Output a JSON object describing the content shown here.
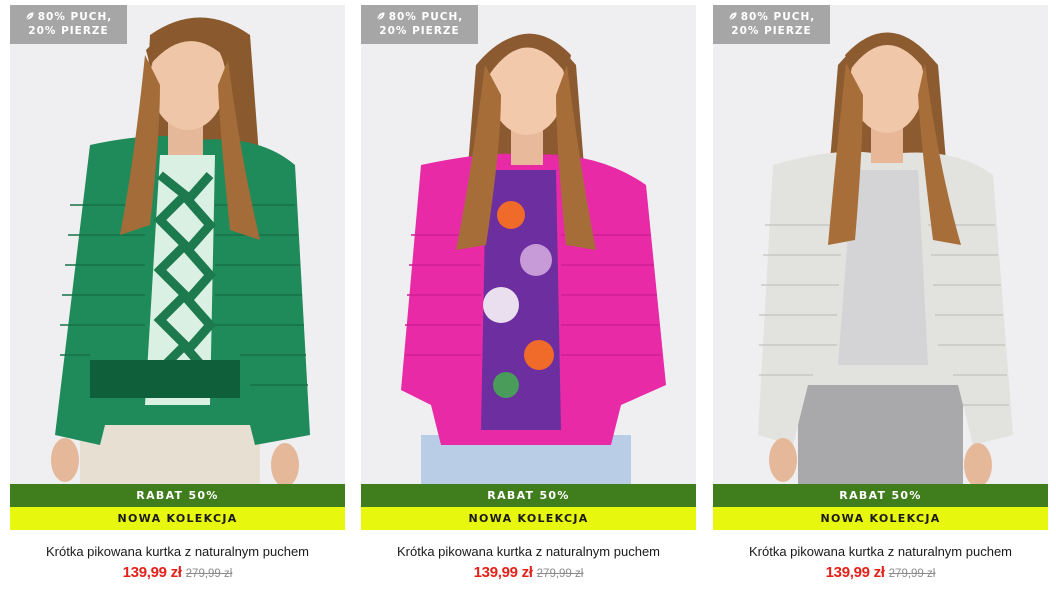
{
  "products": [
    {
      "badge_line1": "80% PUCH,",
      "badge_line2": "20% PIERZE",
      "discount_label": "RABAT 50%",
      "collection_label": "NOWA KOLEKCJA",
      "name": "Krótka pikowana kurtka z naturalnym puchem",
      "price": "139,99 zł",
      "old_price": "279,99 zł",
      "jacket_color": "#1f8a5a"
    },
    {
      "badge_line1": "80% PUCH,",
      "badge_line2": "20% PIERZE",
      "discount_label": "RABAT 50%",
      "collection_label": "NOWA KOLEKCJA",
      "name": "Krótka pikowana kurtka z naturalnym puchem",
      "price": "139,99 zł",
      "old_price": "279,99 zł",
      "jacket_color": "#e82aa6"
    },
    {
      "badge_line1": "80% PUCH,",
      "badge_line2": "20% PIERZE",
      "discount_label": "RABAT 50%",
      "collection_label": "NOWA KOLEKCJA",
      "name": "Krótka pikowana kurtka z naturalnym puchem",
      "price": "139,99 zł",
      "old_price": "279,99 zł",
      "jacket_color": "#e2e2de"
    }
  ],
  "colors": {
    "discount_strip": "#3f7d1d",
    "collection_strip": "#e7f70d",
    "badge_bg": "#a6a6a6",
    "price_red": "#e2231a"
  },
  "icons": {
    "badge_icon": "leaf-icon"
  }
}
